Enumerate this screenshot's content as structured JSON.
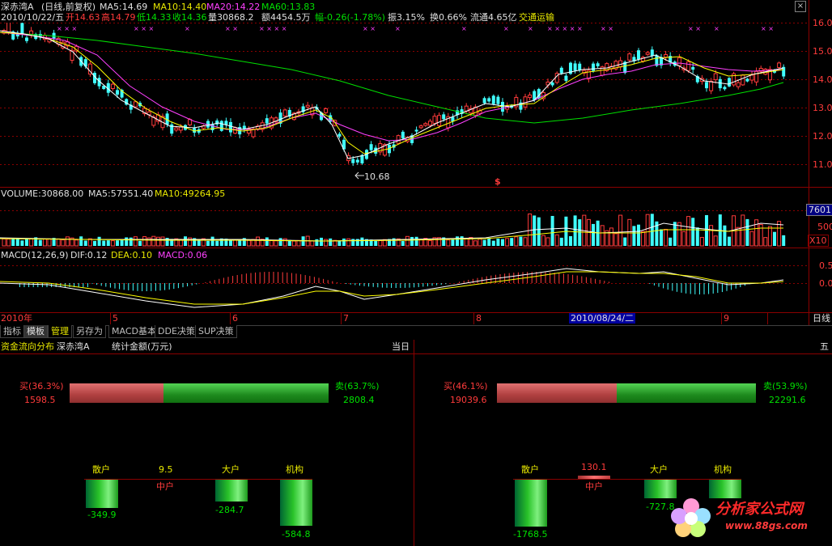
{
  "header": {
    "stock": "深赤湾A",
    "mode": "(日线,前复权)",
    "ma5": "MA5:14.69",
    "ma10": "MA10:14.40",
    "ma20": "MA20:14.22",
    "ma60": "MA60:13.83",
    "info_date": "2010/10/22/五",
    "open": "开14.63",
    "high": "高14.79",
    "low": "低14.33",
    "close": "收14.36",
    "vol": "量30868.2",
    "amount": "额4454.5万",
    "change": "幅-0.26(-1.78%)",
    "amplitude": "振3.15%",
    "turnover": "换0.66%",
    "float": "流通4.65亿",
    "industry": "交通运输"
  },
  "price_axis": [
    "16.0",
    "15.0",
    "14.0",
    "13.0",
    "12.0",
    "11.0"
  ],
  "low_marker": "10.68",
  "signal_marker": "$",
  "volume": {
    "label": "VOLUME:30868.00",
    "ma5": "MA5:57551.40",
    "ma10": "MA10:49264.95",
    "axis_top": "7601",
    "axis_mid": "500",
    "axis_unit": "X10"
  },
  "macd": {
    "label": "MACD(12,26,9)",
    "dif": "DIF:0.12",
    "dea": "DEA:0.10",
    "macd": "MACD:0.06",
    "axis": [
      "0.5",
      "0.0"
    ]
  },
  "time_axis": {
    "items": [
      "2010年",
      "5",
      "6",
      "7",
      "8",
      "2010/08/24/二",
      "9",
      "10"
    ],
    "right": "日线"
  },
  "tabs": [
    "指标",
    "模板",
    "管理",
    "另存为",
    "MACD基本",
    "DDE决策",
    "SUP决策"
  ],
  "panel": {
    "title": "资金流向分布",
    "stock": "深赤湾A",
    "unit": "统计金额(万元)",
    "left_header": "当日",
    "right_header": "五",
    "left": {
      "buy_label": "买(36.3%)",
      "buy_value": "1598.5",
      "buy_pct": 36.3,
      "sell_label": "卖(63.7%)",
      "sell_value": "2808.4",
      "retail": "散户",
      "mid": "中户",
      "large": "大户",
      "inst": "机构",
      "retail_value": "-349.9",
      "mid_value": "9.5",
      "large_value": "-284.7",
      "inst_value": "-584.8"
    },
    "right": {
      "buy_label": "买(46.1%)",
      "buy_value": "19039.6",
      "buy_pct": 46.1,
      "sell_label": "卖(53.9%)",
      "sell_value": "22291.6",
      "retail": "散户",
      "mid": "中户",
      "large": "大户",
      "inst": "机构",
      "retail_value": "-1768.5",
      "mid_value": "130.1",
      "large_value": "-727.8",
      "inst_value": ""
    }
  },
  "watermark": {
    "brand": "分析家公式网",
    "url": "www.88gs.com"
  },
  "colors": {
    "up": "#ff3b3b",
    "down": "#40ffff",
    "ma5": "#ffffff",
    "ma10": "#ffff00",
    "ma20": "#ff40ff",
    "ma60": "#00e000"
  }
}
